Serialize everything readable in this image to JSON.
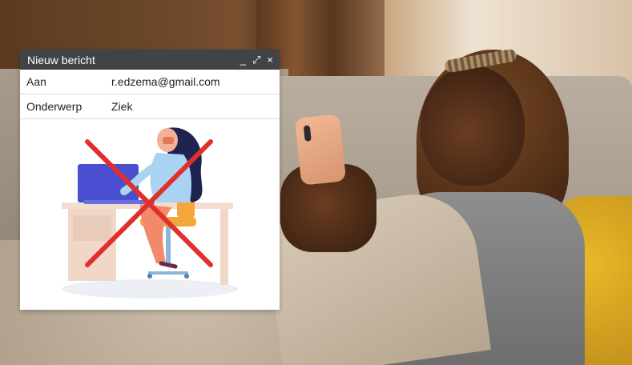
{
  "window": {
    "title": "Nieuw bericht",
    "controls": {
      "minimize": "_",
      "expand": "⤢",
      "close": "×"
    }
  },
  "fields": {
    "to_label": "Aan",
    "to_value": "r.edzema@gmail.com",
    "subject_label": "Onderwerp",
    "subject_value": "Ziek"
  },
  "colors": {
    "header_bg": "#404448",
    "cross": "#e0302b"
  },
  "icons": {
    "minimize": "minimize-icon",
    "expand": "expand-icon",
    "close": "close-icon"
  }
}
